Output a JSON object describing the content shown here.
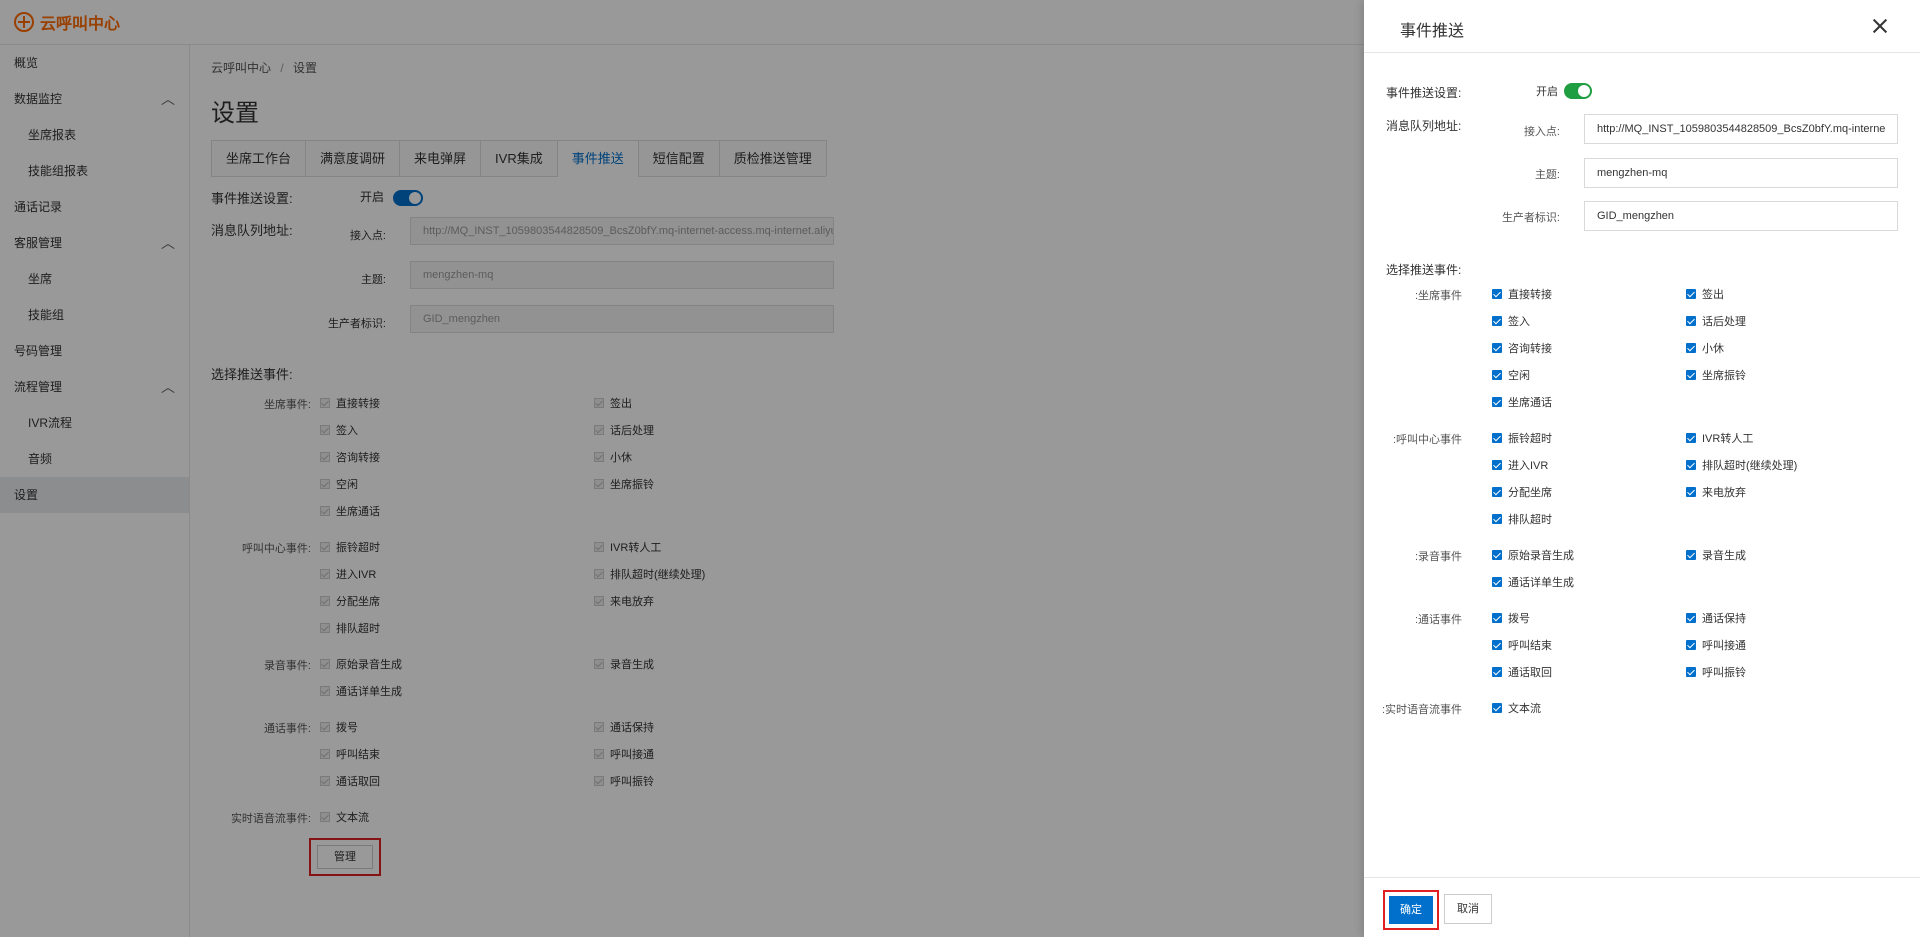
{
  "app": {
    "logo_text": "云呼叫中心"
  },
  "sidebar": {
    "items": [
      {
        "label": "概览",
        "type": "item"
      },
      {
        "label": "数据监控",
        "type": "group"
      },
      {
        "label": "坐席报表",
        "type": "sub"
      },
      {
        "label": "技能组报表",
        "type": "sub"
      },
      {
        "label": "通话记录",
        "type": "item"
      },
      {
        "label": "客服管理",
        "type": "group"
      },
      {
        "label": "坐席",
        "type": "sub"
      },
      {
        "label": "技能组",
        "type": "sub"
      },
      {
        "label": "号码管理",
        "type": "item"
      },
      {
        "label": "流程管理",
        "type": "group"
      },
      {
        "label": "IVR流程",
        "type": "sub"
      },
      {
        "label": "音频",
        "type": "sub"
      },
      {
        "label": "设置",
        "type": "item",
        "active": true
      }
    ]
  },
  "breadcrumb": {
    "root": "云呼叫中心",
    "sep": "/",
    "current": "设置"
  },
  "page_title": "设置",
  "tabs": [
    {
      "label": "坐席工作台"
    },
    {
      "label": "满意度调研"
    },
    {
      "label": "来电弹屏"
    },
    {
      "label": "IVR集成"
    },
    {
      "label": "事件推送",
      "active": true
    },
    {
      "label": "短信配置"
    },
    {
      "label": "质检推送管理"
    }
  ],
  "form": {
    "push_setting_label": "事件推送设置:",
    "toggle_label": "开启",
    "mq_label": "消息队列地址:",
    "endpoint_label": "接入点:",
    "topic_label": "主题:",
    "producer_label": "生产者标识:",
    "bg_endpoint_value": "http://MQ_INST_1059803544828509_BcsZ0bfY.mq-internet-access.mq-internet.aliyu",
    "bg_topic_value": "mengzhen-mq",
    "bg_producer_value": "GID_mengzhen",
    "select_events_label": "选择推送事件:",
    "manage_button": "管理"
  },
  "event_groups": [
    {
      "label": "坐席事件:",
      "items": [
        "直接转接",
        "签出",
        "签入",
        "话后处理",
        "咨询转接",
        "小休",
        "空闲",
        "坐席振铃",
        "坐席通话"
      ]
    },
    {
      "label": "呼叫中心事件:",
      "items": [
        "振铃超时",
        "IVR转人工",
        "进入IVR",
        "排队超时(继续处理)",
        "分配坐席",
        "来电放弃",
        "排队超时"
      ]
    },
    {
      "label": "录音事件:",
      "items": [
        "原始录音生成",
        "录音生成",
        "通话详单生成"
      ]
    },
    {
      "label": "通话事件:",
      "items": [
        "拨号",
        "通话保持",
        "呼叫结束",
        "呼叫接通",
        "通话取回",
        "呼叫振铃"
      ]
    },
    {
      "label": "实时语音流事件:",
      "items": [
        "文本流"
      ]
    }
  ],
  "drawer": {
    "title": "事件推送",
    "endpoint_value": "http://MQ_INST_1059803544828509_BcsZ0bfY.mq-interne",
    "topic_value": "mengzhen-mq",
    "producer_value": "GID_mengzhen",
    "confirm_button": "确定",
    "cancel_button": "取消"
  },
  "colors": {
    "accent": "#0070cc",
    "toggle_on": "#1e9e40",
    "highlight": "#e02020",
    "logo": "#ff6a00"
  }
}
